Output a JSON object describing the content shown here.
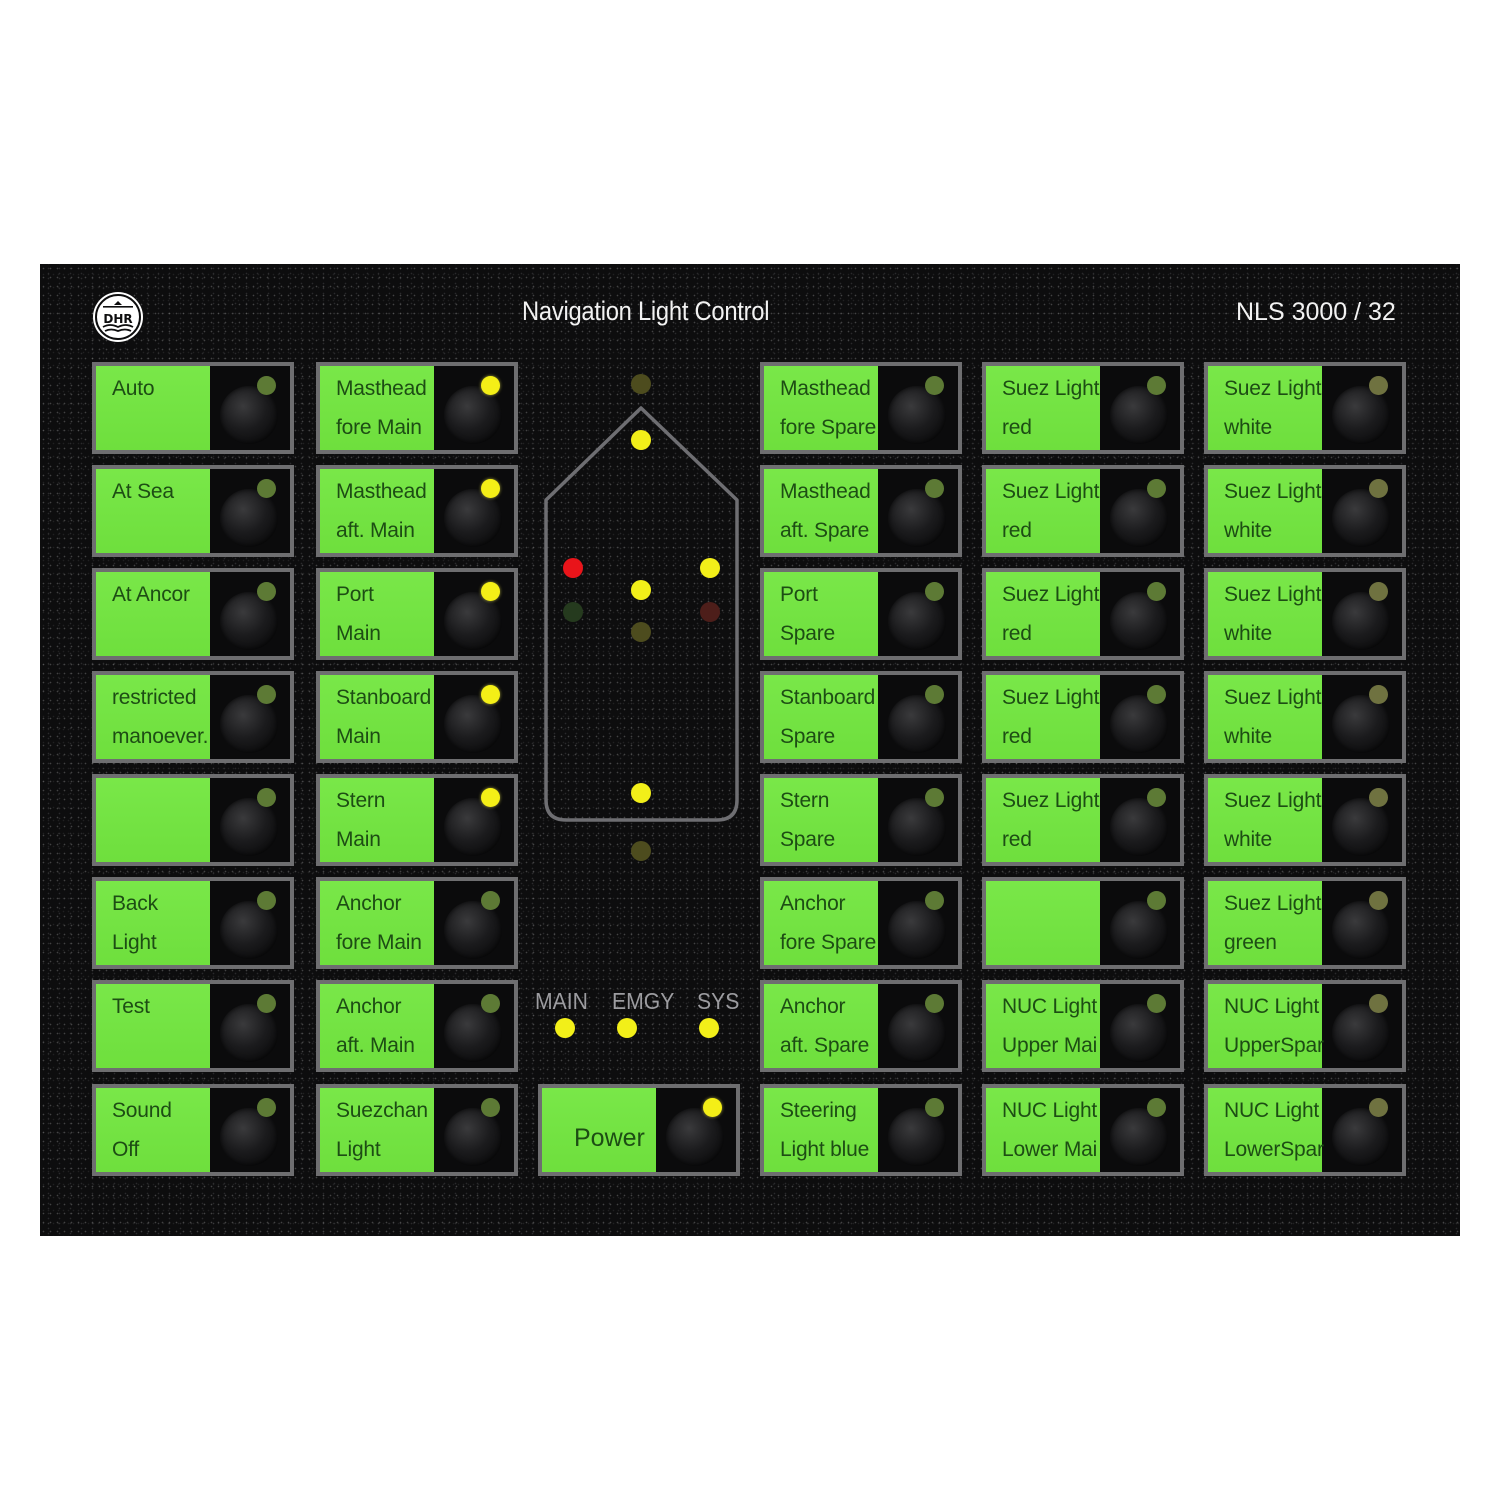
{
  "header": {
    "logo_text": "DHR",
    "title": "Navigation Light Control",
    "model": "NLS 3000 / 32"
  },
  "colors": {
    "panel": "#0d0d0e",
    "lcd_green": "#72e63f",
    "lcd_text": "#1d4d14",
    "led_yellow": "#f4ef17",
    "led_red": "#e9141a",
    "led_off_green": "#5d7a35",
    "bezel": "#6e6e70"
  },
  "columns": [
    {
      "id": "modes",
      "buttons": [
        {
          "line1": "Auto",
          "line2": "",
          "led": "off"
        },
        {
          "line1": "At Sea",
          "line2": "",
          "led": "off"
        },
        {
          "line1": "At Ancor",
          "line2": "",
          "led": "off"
        },
        {
          "line1": "restricted",
          "line2": "manoever.",
          "led": "off"
        },
        {
          "line1": "",
          "line2": "",
          "led": "off"
        },
        {
          "line1": "Back",
          "line2": "Light",
          "led": "off"
        },
        {
          "line1": "Test",
          "line2": "",
          "led": "off"
        },
        {
          "line1": "Sound",
          "line2": "Off",
          "led": "off"
        }
      ]
    },
    {
      "id": "main-lights",
      "buttons": [
        {
          "line1": "Masthead",
          "line2": "fore Main",
          "led": "on"
        },
        {
          "line1": "Masthead",
          "line2": "aft. Main",
          "led": "on"
        },
        {
          "line1": "Port",
          "line2": "Main",
          "led": "on"
        },
        {
          "line1": "Stanboard",
          "line2": "Main",
          "led": "on"
        },
        {
          "line1": "Stern",
          "line2": "Main",
          "led": "on"
        },
        {
          "line1": "Anchor",
          "line2": "fore Main",
          "led": "off"
        },
        {
          "line1": "Anchor",
          "line2": "aft. Main",
          "led": "off"
        },
        {
          "line1": "Suezchan",
          "line2": "Light",
          "led": "off"
        }
      ]
    },
    {
      "id": "spare-lights",
      "buttons": [
        {
          "line1": "Masthead",
          "line2": "fore Spare",
          "led": "off"
        },
        {
          "line1": "Masthead",
          "line2": "aft. Spare",
          "led": "off"
        },
        {
          "line1": "Port",
          "line2": "Spare",
          "led": "off"
        },
        {
          "line1": "Stanboard",
          "line2": "Spare",
          "led": "off"
        },
        {
          "line1": "Stern",
          "line2": "Spare",
          "led": "off"
        },
        {
          "line1": "Anchor",
          "line2": "fore Spare",
          "led": "off"
        },
        {
          "line1": "Anchor",
          "line2": "aft. Spare",
          "led": "off"
        },
        {
          "line1": "Steering",
          "line2": "Light blue",
          "led": "off"
        }
      ]
    },
    {
      "id": "suez-red",
      "buttons": [
        {
          "line1": "Suez Light",
          "line2": "red",
          "led": "off"
        },
        {
          "line1": "Suez Light",
          "line2": "red",
          "led": "off"
        },
        {
          "line1": "Suez Light",
          "line2": "red",
          "led": "off"
        },
        {
          "line1": "Suez Light",
          "line2": "red",
          "led": "off"
        },
        {
          "line1": "Suez Light",
          "line2": "red",
          "led": "off"
        },
        {
          "line1": "",
          "line2": "",
          "led": "off"
        },
        {
          "line1": "NUC Light",
          "line2": "Upper Mai",
          "led": "off"
        },
        {
          "line1": "NUC Light",
          "line2": "Lower Mai",
          "led": "off"
        }
      ]
    },
    {
      "id": "suez-white",
      "buttons": [
        {
          "line1": "Suez Light",
          "line2": "white",
          "led": "offy"
        },
        {
          "line1": "Suez Light",
          "line2": "white",
          "led": "offy"
        },
        {
          "line1": "Suez Light",
          "line2": "white",
          "led": "offy"
        },
        {
          "line1": "Suez Light",
          "line2": "white",
          "led": "offy"
        },
        {
          "line1": "Suez Light",
          "line2": "white",
          "led": "offy"
        },
        {
          "line1": "Suez Light",
          "line2": "green",
          "led": "offy"
        },
        {
          "line1": "NUC Light",
          "line2": "UpperSpar",
          "led": "offy"
        },
        {
          "line1": "NUC Light",
          "line2": "LowerSpar",
          "led": "offy"
        }
      ]
    }
  ],
  "ship_diagram": {
    "leds": [
      {
        "name": "masthead-top-indicator",
        "state": "dim-yellow"
      },
      {
        "name": "masthead-fore-indicator",
        "state": "yellow"
      },
      {
        "name": "port-main-indicator",
        "state": "red"
      },
      {
        "name": "starboard-main-indicator",
        "state": "yellow"
      },
      {
        "name": "masthead-aft-indicator",
        "state": "yellow"
      },
      {
        "name": "port-spare-indicator",
        "state": "dim-green"
      },
      {
        "name": "starboard-spare-indicator",
        "state": "dim-red"
      },
      {
        "name": "masthead-aft-spare-indicator",
        "state": "dim-yellow"
      },
      {
        "name": "stern-main-indicator",
        "state": "yellow"
      },
      {
        "name": "stern-spare-indicator",
        "state": "dim-yellow"
      }
    ]
  },
  "status": {
    "labels": [
      "MAIN",
      "EMGY",
      "SYS"
    ],
    "states": [
      "on",
      "on",
      "on"
    ]
  },
  "power": {
    "label": "Power",
    "led": "on"
  }
}
